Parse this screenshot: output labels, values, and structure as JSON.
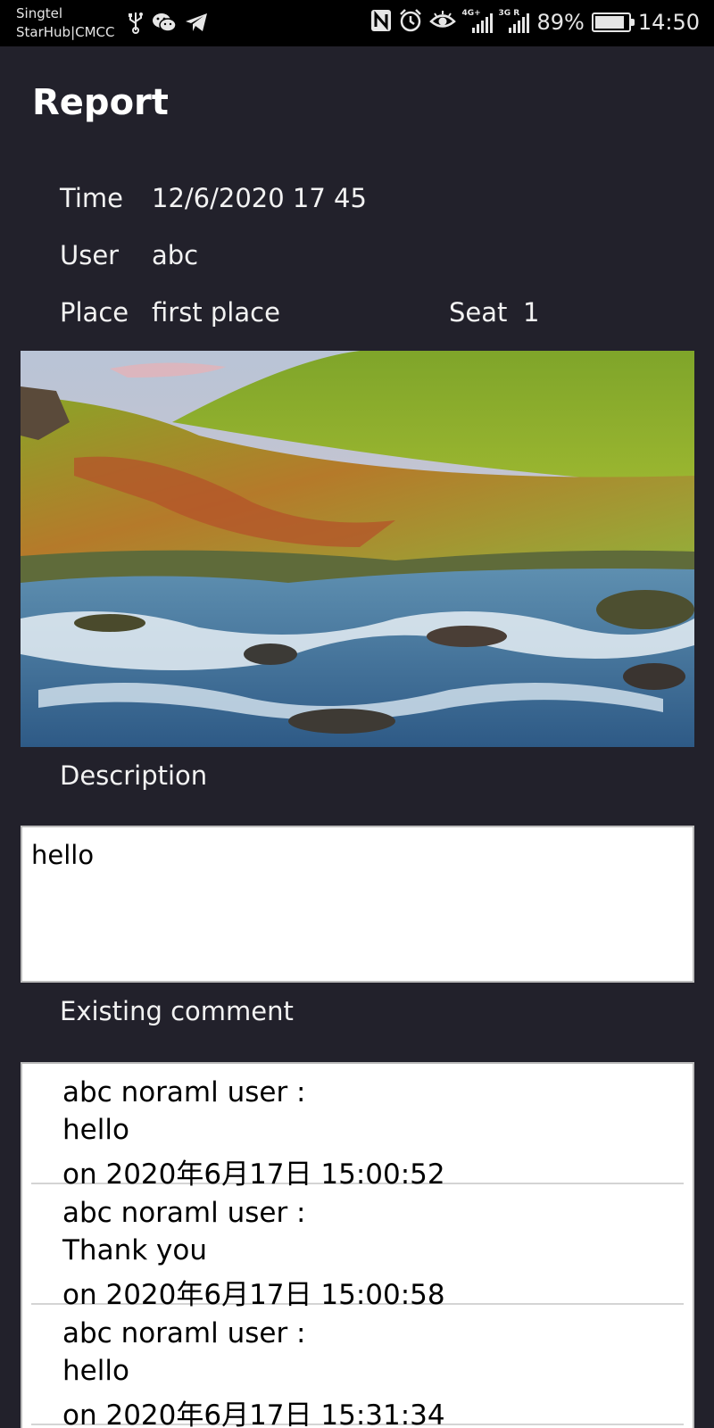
{
  "status_bar": {
    "carrier_1": "Singtel",
    "carrier_2": "StarHub|CMCC",
    "signal_1_tag": "4G+",
    "signal_2_tag": "3G R",
    "battery": "89%",
    "battery_level": 0.89,
    "time": "14:50",
    "icons": [
      "usb-icon",
      "wechat-icon",
      "telegram-icon",
      "nfc-icon",
      "alarm-icon",
      "eye-comfort-icon",
      "signal-icon",
      "battery-icon"
    ]
  },
  "page": {
    "title": "Report"
  },
  "details": {
    "time_label": "Time",
    "time_value": "12/6/2020 17 45",
    "user_label": "User",
    "user_value": "abc",
    "place_label": "Place",
    "place_value": "first place",
    "seat_label": "Seat",
    "seat_value": "1"
  },
  "description": {
    "label": "Description",
    "text": "hello"
  },
  "comments": {
    "label": "Existing comment",
    "items": [
      {
        "author": "abc noraml user :",
        "text": "hello",
        "date": "on 2020年6月17日 15:00:52"
      },
      {
        "author": "abc noraml user :",
        "text": "Thank you",
        "date": "on 2020年6月17日 15:00:58"
      },
      {
        "author": "abc noraml user :",
        "text": "hello",
        "date": "on 2020年6月17日 15:31:34"
      }
    ]
  },
  "colors": {
    "background": "#22212b",
    "status_bar": "#000000",
    "box": "#ffffff"
  }
}
